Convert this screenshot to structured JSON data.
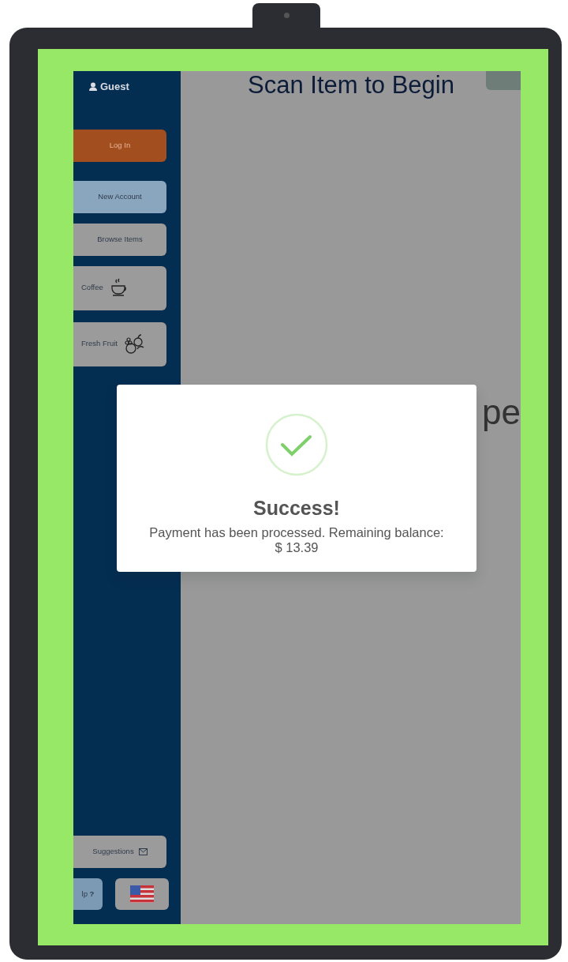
{
  "header": {
    "title": "Scan Item to Begin"
  },
  "sidebar": {
    "user": "Guest",
    "buttons": [
      {
        "kind": "primary",
        "label": "Log In"
      },
      {
        "kind": "secondary",
        "label": "New Account"
      },
      {
        "kind": "plain",
        "label": "Browse Items"
      },
      {
        "kind": "category",
        "label": "Coffee"
      },
      {
        "kind": "category",
        "label": "Fresh Fruit"
      }
    ],
    "suggestions": "Suggestions",
    "help": "lp **?**"
  },
  "logo": {
    "text": "pe"
  },
  "dialog": {
    "title": "Success!",
    "message": "Payment has been processed. Remaining balance: $ 13.39"
  }
}
